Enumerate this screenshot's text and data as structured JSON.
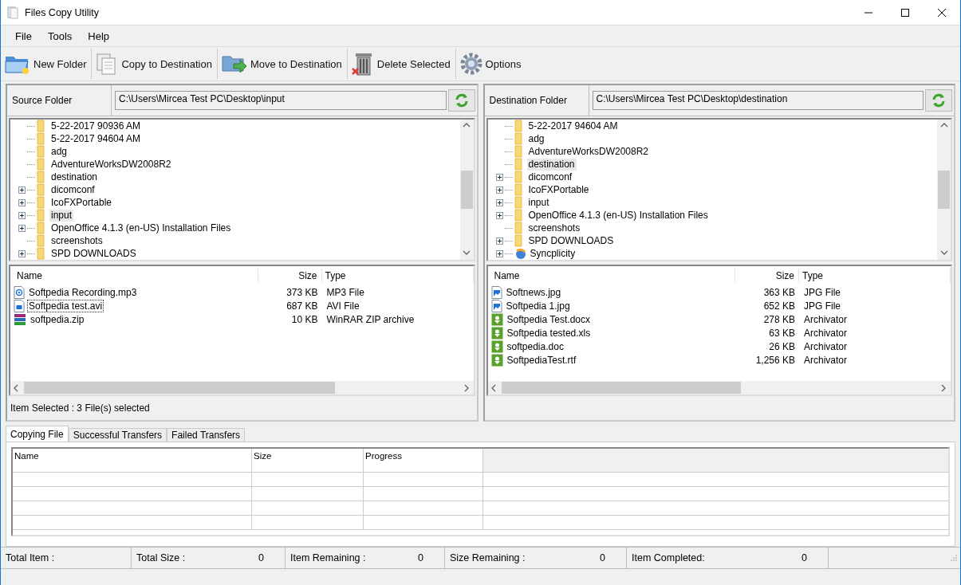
{
  "window": {
    "title": "Files Copy Utility"
  },
  "menu": [
    "File",
    "Tools",
    "Help"
  ],
  "toolbar": [
    {
      "kind": "new-folder",
      "label": "New Folder"
    },
    {
      "kind": "copy",
      "label": "Copy to Destination"
    },
    {
      "kind": "move",
      "label": "Move to Destination"
    },
    {
      "kind": "delete",
      "label": "Delete Selected"
    },
    {
      "kind": "options",
      "label": "Options"
    }
  ],
  "panes": [
    {
      "label": "Source Folder",
      "path": "C:\\Users\\Mircea Test PC\\Desktop\\input",
      "tree": [
        {
          "name": "5-22-2017 90936 AM",
          "kind": "folder",
          "expandable": false,
          "selected": false
        },
        {
          "name": "5-22-2017 94604 AM",
          "kind": "folder",
          "expandable": false,
          "selected": false
        },
        {
          "name": "adg",
          "kind": "folder",
          "expandable": false,
          "selected": false
        },
        {
          "name": "AdventureWorksDW2008R2",
          "kind": "folder",
          "expandable": false,
          "selected": false
        },
        {
          "name": "destination",
          "kind": "folder",
          "expandable": false,
          "selected": false
        },
        {
          "name": "dicomconf",
          "kind": "folder",
          "expandable": true,
          "selected": false
        },
        {
          "name": "IcoFXPortable",
          "kind": "folder",
          "expandable": true,
          "selected": false
        },
        {
          "name": "input",
          "kind": "folder",
          "expandable": true,
          "selected": true
        },
        {
          "name": "OpenOffice 4.1.3 (en-US) Installation Files",
          "kind": "folder",
          "expandable": true,
          "selected": false
        },
        {
          "name": "screenshots",
          "kind": "folder",
          "expandable": false,
          "selected": false
        },
        {
          "name": "SPD DOWNLOADS",
          "kind": "folder",
          "expandable": true,
          "selected": false
        }
      ],
      "columns": [
        "Name",
        "Size",
        "Type"
      ],
      "files": [
        {
          "name": "Softpedia Recording.mp3",
          "size": "373 KB",
          "type": "MP3 File",
          "kind": "audio",
          "focused": false
        },
        {
          "name": "Softpedia test.avi",
          "size": "687 KB",
          "type": "AVI File",
          "kind": "video",
          "focused": true
        },
        {
          "name": "softpedia.zip",
          "size": "10 KB",
          "type": "WinRAR ZIP archive",
          "kind": "archive",
          "focused": false
        }
      ],
      "status": "Item Selected :  3 File(s) selected"
    },
    {
      "label": "Destination Folder",
      "path": "C:\\Users\\Mircea Test PC\\Desktop\\destination",
      "tree": [
        {
          "name": "5-22-2017 94604 AM",
          "kind": "folder",
          "expandable": false,
          "selected": false
        },
        {
          "name": "adg",
          "kind": "folder",
          "expandable": false,
          "selected": false
        },
        {
          "name": "AdventureWorksDW2008R2",
          "kind": "folder",
          "expandable": false,
          "selected": false
        },
        {
          "name": "destination",
          "kind": "folder",
          "expandable": false,
          "selected": true
        },
        {
          "name": "dicomconf",
          "kind": "folder",
          "expandable": true,
          "selected": false
        },
        {
          "name": "IcoFXPortable",
          "kind": "folder",
          "expandable": true,
          "selected": false
        },
        {
          "name": "input",
          "kind": "folder",
          "expandable": true,
          "selected": false
        },
        {
          "name": "OpenOffice 4.1.3 (en-US) Installation Files",
          "kind": "folder",
          "expandable": true,
          "selected": false
        },
        {
          "name": "screenshots",
          "kind": "folder",
          "expandable": false,
          "selected": false
        },
        {
          "name": "SPD DOWNLOADS",
          "kind": "folder",
          "expandable": true,
          "selected": false
        },
        {
          "name": "Syncplicity",
          "kind": "sync",
          "expandable": true,
          "selected": false
        }
      ],
      "columns": [
        "Name",
        "Size",
        "Type"
      ],
      "files": [
        {
          "name": "Softnews.jpg",
          "size": "363 KB",
          "type": "JPG File",
          "kind": "image",
          "focused": false
        },
        {
          "name": "Softpedia 1.jpg",
          "size": "652 KB",
          "type": "JPG File",
          "kind": "image",
          "focused": false
        },
        {
          "name": "Softpedia Test.docx",
          "size": "278 KB",
          "type": "Archivator",
          "kind": "green",
          "focused": false
        },
        {
          "name": "Softpedia tested.xls",
          "size": "63 KB",
          "type": "Archivator",
          "kind": "green",
          "focused": false
        },
        {
          "name": "softpedia.doc",
          "size": "26 KB",
          "type": "Archivator",
          "kind": "green",
          "focused": false
        },
        {
          "name": "SoftpediaTest.rtf",
          "size": "1,256 KB",
          "type": "Archivator",
          "kind": "green",
          "focused": false
        }
      ]
    }
  ],
  "transfer_tabs": [
    {
      "label": "Copying File",
      "selected": true
    },
    {
      "label": "Successful Transfers",
      "selected": false
    },
    {
      "label": "Failed Transfers",
      "selected": false
    }
  ],
  "transfer_columns": [
    "Name",
    "Size",
    "Progress"
  ],
  "status_bar": [
    {
      "label": "Total Item :"
    },
    {
      "label": "Total Size :",
      "value": "0"
    },
    {
      "label": "Item Remaining :",
      "value": "0"
    },
    {
      "label": "Size Remaining :",
      "value": "0"
    },
    {
      "label": "Item Completed:",
      "value": "0"
    }
  ]
}
